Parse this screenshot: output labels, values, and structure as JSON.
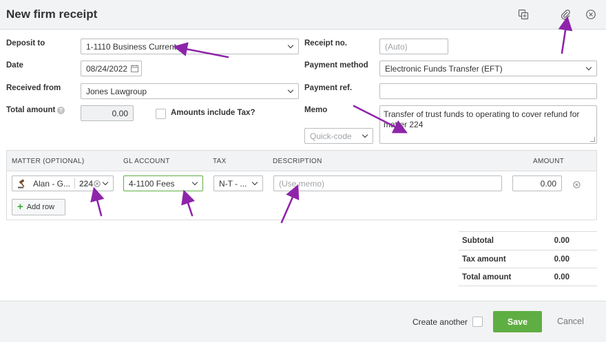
{
  "window": {
    "title": "New firm receipt"
  },
  "form": {
    "deposit_to": {
      "label": "Deposit to",
      "value": "1-1110 Business Current"
    },
    "date": {
      "label": "Date",
      "value": "08/24/2022"
    },
    "received_from": {
      "label": "Received from",
      "value": "Jones Lawgroup"
    },
    "total_amount": {
      "label": "Total amount",
      "value": "0.00",
      "help": "?"
    },
    "amounts_include_tax": {
      "label": "Amounts include Tax?",
      "checked": false
    },
    "receipt_no": {
      "label": "Receipt no.",
      "placeholder": "(Auto)"
    },
    "payment_method": {
      "label": "Payment method",
      "value": "Electronic Funds Transfer (EFT)"
    },
    "payment_ref": {
      "label": "Payment ref.",
      "value": ""
    },
    "memo": {
      "label": "Memo",
      "value": "Transfer of trust funds to operating to cover refund for matter 224"
    },
    "quick_code": {
      "placeholder": "Quick-code"
    }
  },
  "grid": {
    "columns": {
      "matter": "MATTER (OPTIONAL)",
      "gl_account": "GL ACCOUNT",
      "tax": "TAX",
      "description": "DESCRIPTION",
      "amount": "AMOUNT"
    },
    "rows": [
      {
        "matter_name": "Alan - G...",
        "matter_number": "224",
        "gl_account": "4-1100 Fees",
        "tax": "N-T - ...",
        "description_placeholder": "(Use memo)",
        "amount": "0.00"
      }
    ],
    "add_row_label": "Add row"
  },
  "totals": {
    "subtotal": {
      "label": "Subtotal",
      "value": "0.00"
    },
    "tax_amount": {
      "label": "Tax amount",
      "value": "0.00"
    },
    "total_amount": {
      "label": "Total amount",
      "value": "0.00"
    }
  },
  "footer": {
    "create_another_label": "Create another",
    "create_another_checked": false,
    "save_label": "Save",
    "cancel_label": "Cancel"
  },
  "colors": {
    "accent_green": "#5fae43",
    "annotation_purple": "#8e24aa",
    "header_bg": "#f2f3f4"
  },
  "icons": [
    "copy-icon",
    "attachment-icon",
    "close-icon",
    "calendar-icon",
    "gavel-icon",
    "clear-icon",
    "remove-row-icon",
    "plus-icon"
  ]
}
